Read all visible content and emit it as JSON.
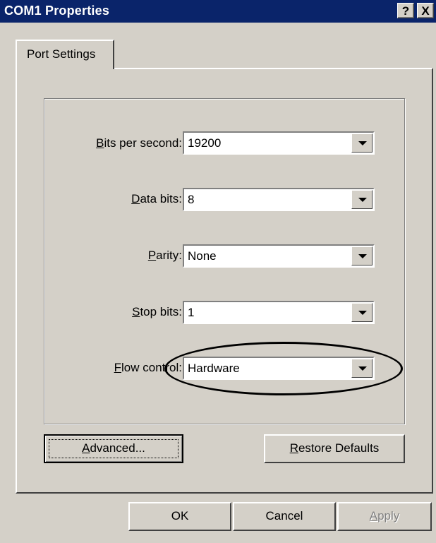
{
  "window": {
    "title": "COM1 Properties",
    "help_button": "?",
    "close_button": "X"
  },
  "tabs": [
    {
      "label": "Port Settings",
      "selected": true
    }
  ],
  "fields": [
    {
      "label": "Bits per second:",
      "mnemonic": "B",
      "label_rest": "its per second:",
      "value": "19200"
    },
    {
      "label": "Data bits:",
      "mnemonic": "D",
      "label_rest": "ata bits:",
      "value": "8"
    },
    {
      "label": "Parity:",
      "mnemonic": "P",
      "label_rest": "arity:",
      "value": "None"
    },
    {
      "label": "Stop bits:",
      "mnemonic": "S",
      "label_rest": "top bits:",
      "value": "1"
    },
    {
      "label": "Flow control:",
      "mnemonic": "F",
      "label_rest": "low control:",
      "value": "Hardware"
    }
  ],
  "buttons": {
    "advanced": {
      "mnemonic": "A",
      "rest": "dvanced..."
    },
    "restore_defaults": {
      "mnemonic": "R",
      "rest": "estore Defaults"
    },
    "ok": "OK",
    "cancel": "Cancel",
    "apply": {
      "mnemonic": "A",
      "rest": "pply",
      "disabled": true
    }
  },
  "annotation": {
    "shape": "ellipse",
    "highlights": "flow-control"
  }
}
